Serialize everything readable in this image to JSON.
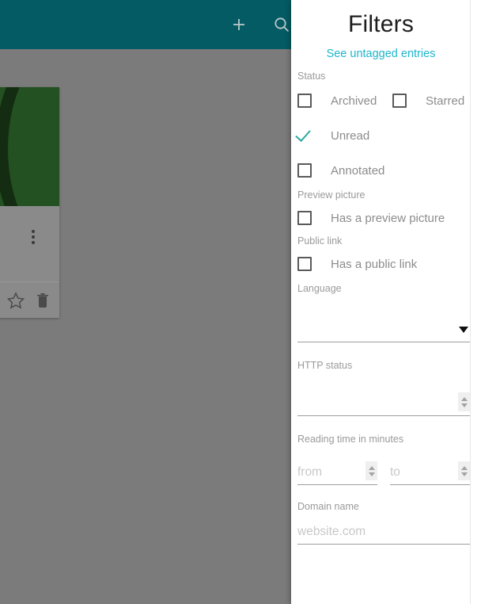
{
  "app": {
    "toolbar": {
      "add_icon": "plus-icon",
      "search_icon": "search-icon",
      "background_color": "#055b63"
    },
    "card": {
      "menu_icon": "more-vertical-icon",
      "star_icon": "star-outline-icon",
      "delete_icon": "trash-icon",
      "preview_color": "#235121",
      "preview_accent_color": "#142d12"
    },
    "scrim_color": "#7b7b7b"
  },
  "filters": {
    "title": "Filters",
    "untagged_link": "See untagged entries",
    "link_color": "#1fb6cd",
    "check_color": "#2aa9a0",
    "sections": {
      "status": {
        "label": "Status",
        "options": [
          {
            "label": "Archived",
            "checked": false
          },
          {
            "label": "Starred",
            "checked": false
          },
          {
            "label": "Unread",
            "checked": true
          },
          {
            "label": "Annotated",
            "checked": false
          }
        ]
      },
      "preview_picture": {
        "label": "Preview picture",
        "option": {
          "label": "Has a preview picture",
          "checked": false
        }
      },
      "public_link": {
        "label": "Public link",
        "option": {
          "label": "Has a public link",
          "checked": false
        }
      },
      "language": {
        "label": "Language",
        "value": "",
        "placeholder": "",
        "caret_icon": "chevron-down-icon"
      },
      "http_status": {
        "label": "HTTP status",
        "value": "",
        "placeholder": "",
        "spinner_icon": "number-spinner-icon"
      },
      "reading_time": {
        "label": "Reading time in minutes",
        "from_placeholder": "from",
        "from_value": "",
        "to_placeholder": "to",
        "to_value": "",
        "spinner_icon": "number-spinner-icon"
      },
      "domain_name": {
        "label": "Domain name",
        "placeholder": "website.com",
        "value": ""
      }
    }
  }
}
